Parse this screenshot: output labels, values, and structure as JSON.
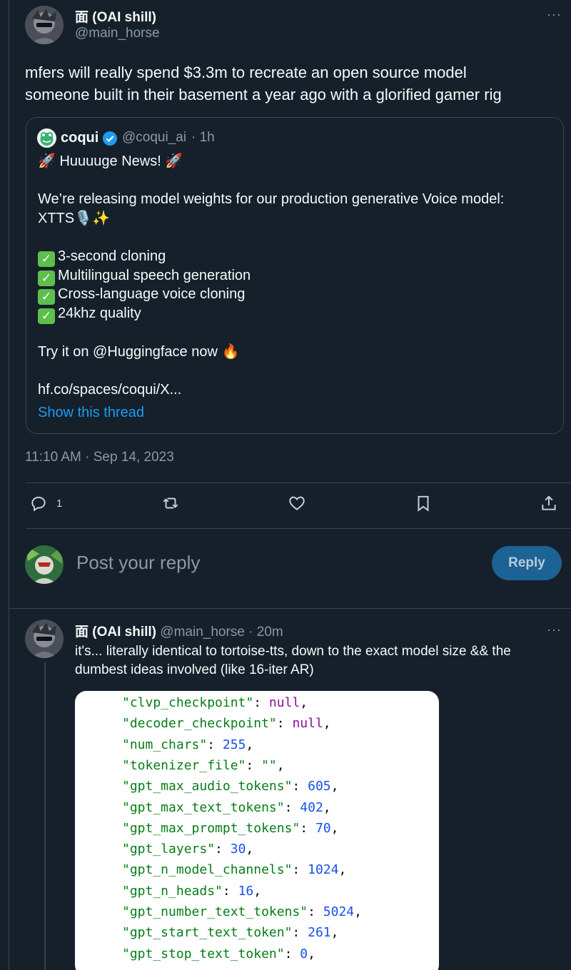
{
  "main_tweet": {
    "display_name": "面 (OAI shill)",
    "handle": "@main_horse",
    "more_label": "···",
    "text_line1": "mfers will really spend $3.3m to recreate an open source model",
    "text_line2": "someone built in their basement a year ago with a glorified gamer rig",
    "timestamp": "11:10 AM · Sep 14, 2023"
  },
  "quoted_tweet": {
    "display_name": "coqui",
    "verified_icon": "verified-badge-icon",
    "handle": "@coqui_ai",
    "time": "· 1h",
    "headline": "Huuuuge News!",
    "line1": "We’re releasing model weights for our production generative Voice model:",
    "line2": "XTTS",
    "features": [
      "3-second cloning",
      "Multilingual speech generation",
      "Cross-language voice cloning",
      "24khz quality"
    ],
    "try_line": "Try it on @Huggingface now",
    "link": "hf.co/spaces/coqui/X...",
    "show_thread": "Show this thread"
  },
  "actions": {
    "reply_count": "1",
    "icons": [
      "reply-icon",
      "retweet-icon",
      "like-icon",
      "bookmark-icon",
      "share-icon"
    ]
  },
  "composer": {
    "placeholder": "Post your reply",
    "reply_button": "Reply"
  },
  "reply_tweet": {
    "display_name": "面 (OAI shill)",
    "handle": "@main_horse",
    "time": "· 20m",
    "more_label": "···",
    "text_line1": "it's... literally identical to tortoise-tts, down to the exact model size && the",
    "text_line2": "dumbest ideas involved (like 16-iter AR)",
    "code_lines": [
      {
        "key": "\"clvp_checkpoint\"",
        "sep": ": ",
        "val": "null",
        "kind": "kw"
      },
      {
        "key": "\"decoder_checkpoint\"",
        "sep": ": ",
        "val": "null",
        "kind": "kw"
      },
      {
        "key": "\"num_chars\"",
        "sep": ": ",
        "val": "255",
        "kind": "n"
      },
      {
        "key": "\"tokenizer_file\"",
        "sep": ": ",
        "val": "\"\"",
        "kind": "k"
      },
      {
        "key": "\"gpt_max_audio_tokens\"",
        "sep": ": ",
        "val": "605",
        "kind": "n"
      },
      {
        "key": "\"gpt_max_text_tokens\"",
        "sep": ": ",
        "val": "402",
        "kind": "n"
      },
      {
        "key": "\"gpt_max_prompt_tokens\"",
        "sep": ": ",
        "val": "70",
        "kind": "n"
      },
      {
        "key": "\"gpt_layers\"",
        "sep": ": ",
        "val": "30",
        "kind": "n"
      },
      {
        "key": "\"gpt_n_model_channels\"",
        "sep": ": ",
        "val": "1024",
        "kind": "n"
      },
      {
        "key": "\"gpt_n_heads\"",
        "sep": ": ",
        "val": "16",
        "kind": "n"
      },
      {
        "key": "\"gpt_number_text_tokens\"",
        "sep": ": ",
        "val": "5024",
        "kind": "n"
      },
      {
        "key": "\"gpt_start_text_token\"",
        "sep": ": ",
        "val": "261",
        "kind": "n"
      },
      {
        "key": "\"gpt_stop_text_token\"",
        "sep": ": ",
        "val": "0",
        "kind": "n"
      }
    ]
  },
  "colors": {
    "background": "#15202b",
    "accent": "#1d9bf0",
    "muted": "#8b98a5",
    "border": "#38444d"
  }
}
